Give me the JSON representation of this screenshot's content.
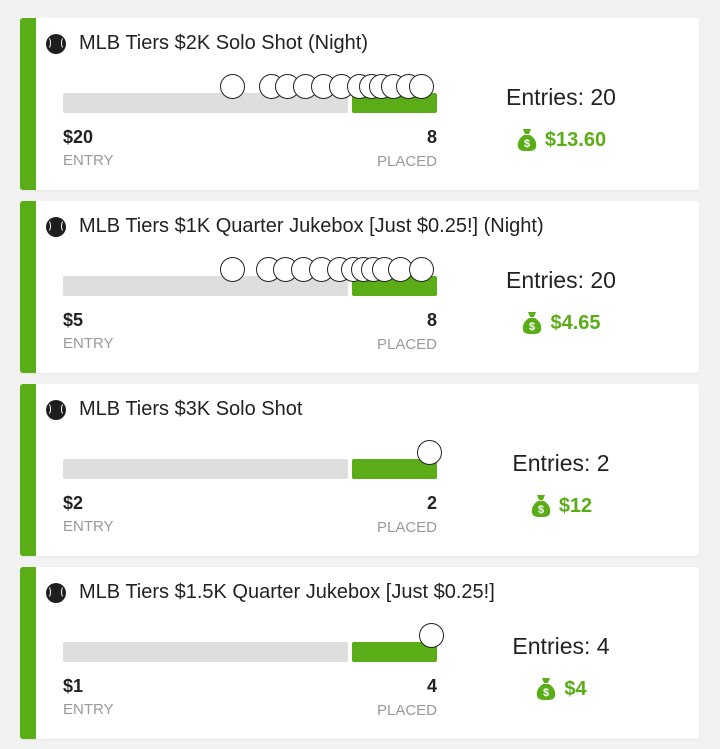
{
  "colors": {
    "accent": "#5aad16",
    "track": "#dedede"
  },
  "icons": {
    "sport": "baseball-icon",
    "prize": "money-bag-icon"
  },
  "contests": [
    {
      "title": "MLB Tiers $2K Solo Shot (Night)",
      "entry_fee": "$20",
      "entry_label": "ENTRY",
      "placed": "8",
      "placed_label": "PLACED",
      "entries": "Entries: 20",
      "prize": "$13.60"
    },
    {
      "title": "MLB Tiers $1K Quarter Jukebox [Just $0.25!] (Night)",
      "entry_fee": "$5",
      "entry_label": "ENTRY",
      "placed": "8",
      "placed_label": "PLACED",
      "entries": "Entries: 20",
      "prize": "$4.65"
    },
    {
      "title": "MLB Tiers $3K Solo Shot",
      "entry_fee": "$2",
      "entry_label": "ENTRY",
      "placed": "2",
      "placed_label": "PLACED",
      "entries": "Entries: 2",
      "prize": "$12"
    },
    {
      "title": "MLB Tiers $1.5K Quarter Jukebox [Just $0.25!]",
      "entry_fee": "$1",
      "entry_label": "ENTRY",
      "placed": "4",
      "placed_label": "PLACED",
      "entries": "Entries: 4",
      "prize": "$4"
    }
  ]
}
